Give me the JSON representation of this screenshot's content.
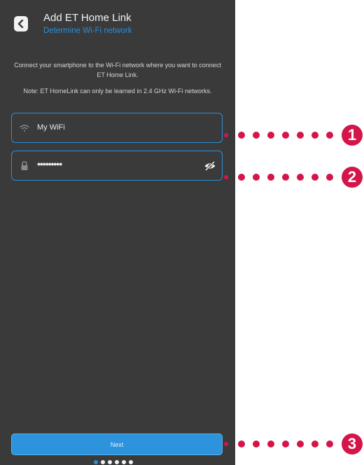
{
  "header": {
    "title": "Add ET Home Link",
    "subtitle": "Determine Wi-Fi network"
  },
  "intro_text": "Connect your smartphone to the Wi-Fi network where you want to connect ET Home Link.",
  "note_text": "Note: ET HomeLink can only be learned in 2.4 GHz Wi-Fi networks.",
  "wifi_field": {
    "value": "My WiFi",
    "icon": "wifi-icon"
  },
  "password_field": {
    "value": "•••••••••",
    "icon": "lock-icon",
    "toggle_icon": "eye-slash-icon"
  },
  "next_button": {
    "label": "Next"
  },
  "pager": {
    "total": 6,
    "active": 1
  },
  "callouts": [
    "1",
    "2",
    "3"
  ],
  "colors": {
    "accent": "#2a8fd8",
    "callout": "#d4154a",
    "background": "#3a3a3a"
  }
}
